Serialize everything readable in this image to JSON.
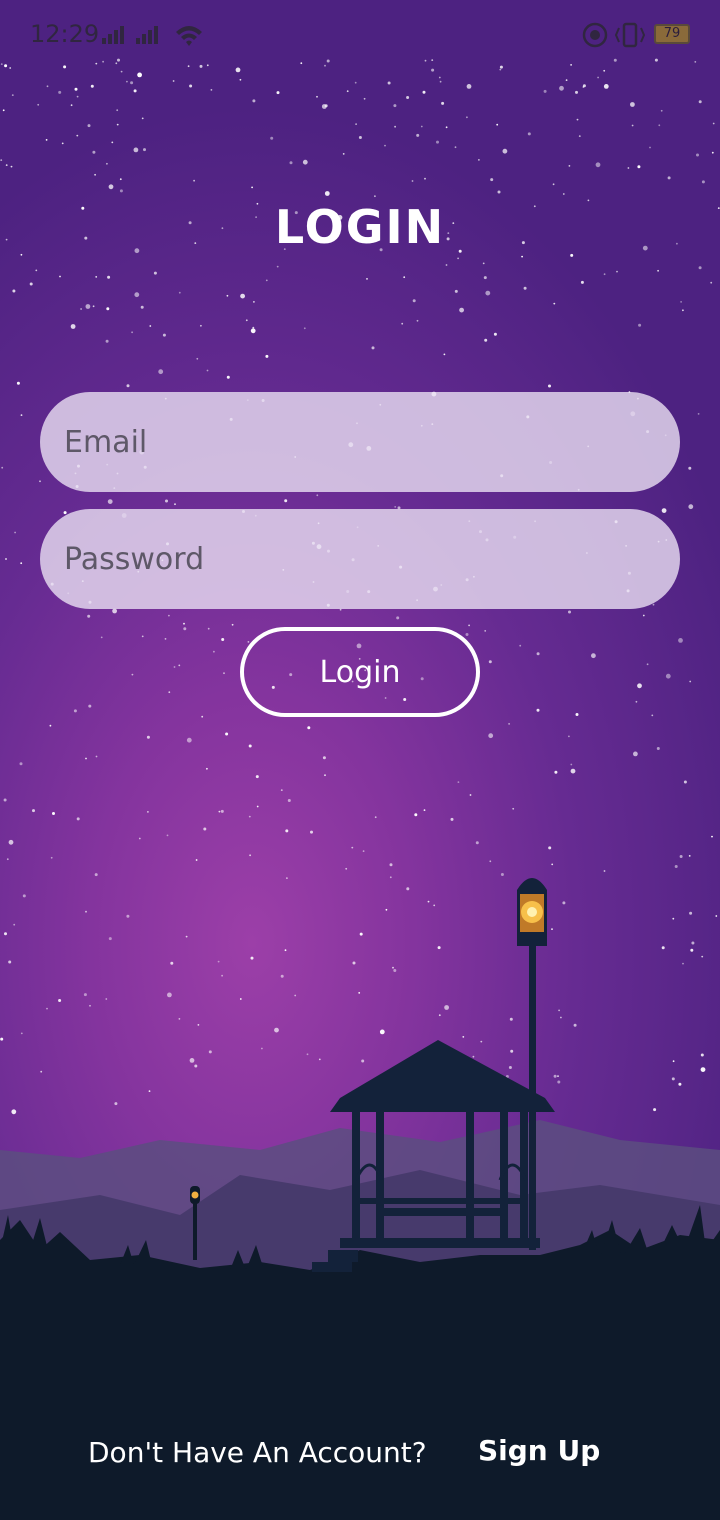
{
  "status_bar": {
    "time": "12:29",
    "battery": "79"
  },
  "screen": {
    "title": "LOGIN"
  },
  "form": {
    "email_placeholder": "Email",
    "password_placeholder": "Password",
    "login_label": "Login"
  },
  "footer": {
    "prompt": "Don't Have An Account?",
    "signup_label": "Sign Up"
  },
  "colors": {
    "sky_top": "#4d2281",
    "sky_glow": "#9c3fa8",
    "ground": "#0e1a2a",
    "hills": "#5c4d80",
    "lantern": "#f0b040"
  },
  "icons": [
    "signal-icon",
    "wifi-icon",
    "record-icon",
    "vibrate-icon",
    "battery-icon",
    "star-field",
    "gazebo-silhouette",
    "lamp-post-icon"
  ]
}
